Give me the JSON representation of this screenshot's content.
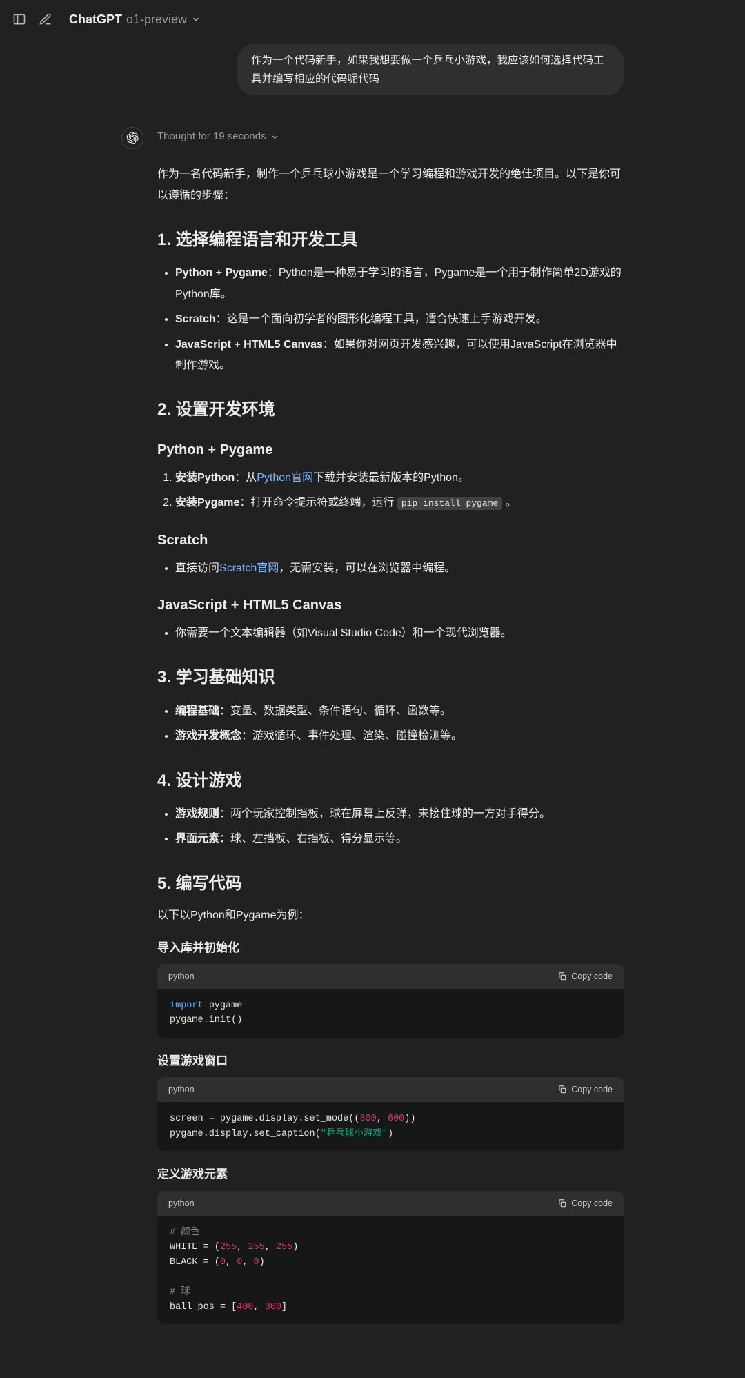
{
  "header": {
    "model_main": "ChatGPT",
    "model_sub": "o1-preview"
  },
  "user_message": "作为一个代码新手，如果我想要做一个乒乓小游戏，我应该如何选择代码工具并编写相应的代码呢代码",
  "thought": "Thought for 19 seconds",
  "intro": "作为一名代码新手，制作一个乒乓球小游戏是一个学习编程和游戏开发的绝佳项目。以下是你可以遵循的步骤：",
  "sections": {
    "s1": {
      "title": "1. 选择编程语言和开发工具",
      "items": [
        {
          "bold": "Python + Pygame",
          "rest": "：Python是一种易于学习的语言，Pygame是一个用于制作简单2D游戏的Python库。"
        },
        {
          "bold": "Scratch",
          "rest": "：这是一个面向初学者的图形化编程工具，适合快速上手游戏开发。"
        },
        {
          "bold": "JavaScript + HTML5 Canvas",
          "rest": "：如果你对网页开发感兴趣，可以使用JavaScript在浏览器中制作游戏。"
        }
      ]
    },
    "s2": {
      "title": "2. 设置开发环境",
      "python_h": "Python + Pygame",
      "python_steps": [
        {
          "bold": "安装Python",
          "pre": "：从",
          "link": "Python官网",
          "post": "下载并安装最新版本的Python。"
        },
        {
          "bold": "安装Pygame",
          "pre": "：打开命令提示符或终端，运行 ",
          "code": "pip install pygame",
          "post": " 。"
        }
      ],
      "scratch_h": "Scratch",
      "scratch_item_pre": "直接访问",
      "scratch_link": "Scratch官网",
      "scratch_item_post": "，无需安装，可以在浏览器中编程。",
      "js_h": "JavaScript + HTML5 Canvas",
      "js_item": "你需要一个文本编辑器（如Visual Studio Code）和一个现代浏览器。"
    },
    "s3": {
      "title": "3. 学习基础知识",
      "items": [
        {
          "bold": "编程基础",
          "rest": "：变量、数据类型、条件语句、循环、函数等。"
        },
        {
          "bold": "游戏开发概念",
          "rest": "：游戏循环、事件处理、渲染、碰撞检测等。"
        }
      ]
    },
    "s4": {
      "title": "4. 设计游戏",
      "items": [
        {
          "bold": "游戏规则",
          "rest": "：两个玩家控制挡板，球在屏幕上反弹，未接住球的一方对手得分。"
        },
        {
          "bold": "界面元素",
          "rest": "：球、左挡板、右挡板、得分显示等。"
        }
      ]
    },
    "s5": {
      "title": "5. 编写代码",
      "intro": "以下以Python和Pygame为例：",
      "cb1_h": "导入库并初始化",
      "cb2_h": "设置游戏窗口",
      "cb3_h": "定义游戏元素"
    }
  },
  "code_lang": "python",
  "copy_label": "Copy code",
  "code1": {
    "tokens": [
      [
        {
          "t": "import",
          "c": "kw"
        },
        {
          "t": " pygame",
          "c": "plain"
        }
      ],
      [
        {
          "t": "pygame.init()",
          "c": "plain"
        }
      ]
    ]
  },
  "code2": {
    "tokens": [
      [
        {
          "t": "screen = pygame.display.set_mode((",
          "c": "plain"
        },
        {
          "t": "800",
          "c": "num"
        },
        {
          "t": ", ",
          "c": "plain"
        },
        {
          "t": "600",
          "c": "num"
        },
        {
          "t": "))",
          "c": "plain"
        }
      ],
      [
        {
          "t": "pygame.display.set_caption(",
          "c": "plain"
        },
        {
          "t": "\"乒乓球小游戏\"",
          "c": "str"
        },
        {
          "t": ")",
          "c": "plain"
        }
      ]
    ]
  },
  "code3": {
    "tokens": [
      [
        {
          "t": "# 颜色",
          "c": "cm"
        }
      ],
      [
        {
          "t": "WHITE = (",
          "c": "plain"
        },
        {
          "t": "255",
          "c": "num"
        },
        {
          "t": ", ",
          "c": "plain"
        },
        {
          "t": "255",
          "c": "num"
        },
        {
          "t": ", ",
          "c": "plain"
        },
        {
          "t": "255",
          "c": "num"
        },
        {
          "t": ")",
          "c": "plain"
        }
      ],
      [
        {
          "t": "BLACK = (",
          "c": "plain"
        },
        {
          "t": "0",
          "c": "num"
        },
        {
          "t": ", ",
          "c": "plain"
        },
        {
          "t": "0",
          "c": "num"
        },
        {
          "t": ", ",
          "c": "plain"
        },
        {
          "t": "0",
          "c": "num"
        },
        {
          "t": ")",
          "c": "plain"
        }
      ],
      [
        {
          "t": "",
          "c": "plain"
        }
      ],
      [
        {
          "t": "# 球",
          "c": "cm"
        }
      ],
      [
        {
          "t": "ball_pos = [",
          "c": "plain"
        },
        {
          "t": "400",
          "c": "num"
        },
        {
          "t": ", ",
          "c": "plain"
        },
        {
          "t": "300",
          "c": "num"
        },
        {
          "t": "]",
          "c": "plain"
        }
      ]
    ]
  }
}
